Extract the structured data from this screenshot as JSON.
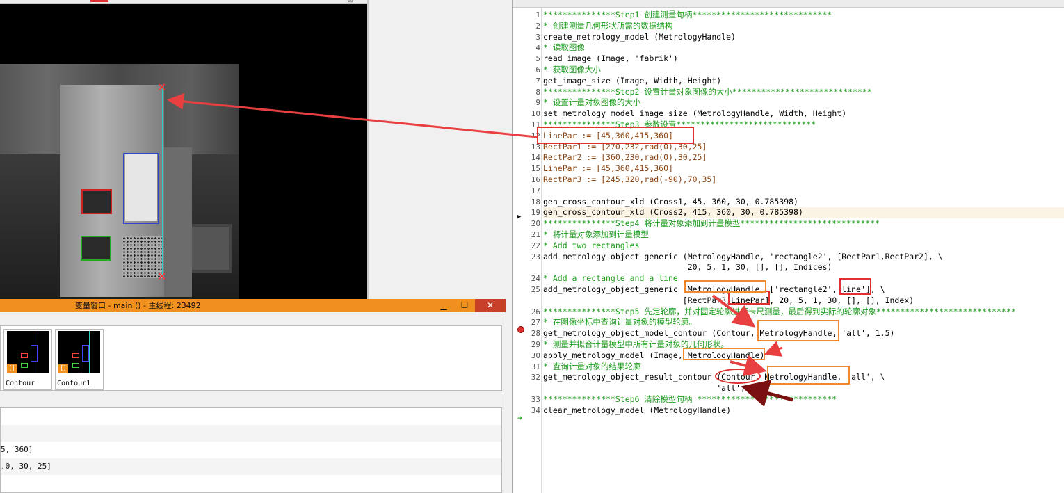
{
  "variable_window": {
    "title": "变量窗口 - main () - 主线程: 23492",
    "thumbs": [
      {
        "label": "Contour",
        "badge": "[]"
      },
      {
        "label": "Contour1",
        "badge": "[]"
      }
    ],
    "rows": [
      "",
      "",
      "5, 360]",
      ".0, 30, 25]"
    ]
  },
  "editor": {
    "lines": [
      {
        "n": "1",
        "t": "***************Step1 创建测量句柄*****************************",
        "c": "cmt"
      },
      {
        "n": "2",
        "t": "* 创建测量几何形状所需的数据结构",
        "c": "cmt"
      },
      {
        "n": "3",
        "t": "create_metrology_model (MetrologyHandle)",
        "c": "kw"
      },
      {
        "n": "4",
        "t": "* 读取图像",
        "c": "cmt"
      },
      {
        "n": "5",
        "t": "read_image (Image, 'fabrik')",
        "c": "kw"
      },
      {
        "n": "6",
        "t": "* 获取图像大小",
        "c": "cmt"
      },
      {
        "n": "7",
        "t": "get_image_size (Image, Width, Height)",
        "c": "kw"
      },
      {
        "n": "8",
        "t": "***************Step2 设置计量对象图像的大小*****************************",
        "c": "cmt"
      },
      {
        "n": "9",
        "t": "* 设置计量对象图像的大小",
        "c": "cmt"
      },
      {
        "n": "10",
        "t": "set_metrology_model_image_size (MetrologyHandle, Width, Height)",
        "c": "kw"
      },
      {
        "n": "11",
        "t": "***************Step3 参数设置*****************************",
        "c": "cmt"
      },
      {
        "n": "12",
        "t": "LinePar := [45,360,415,360]",
        "c": "var"
      },
      {
        "n": "13",
        "t": "RectPar1 := [270,232,rad(0),30,25]",
        "c": "var"
      },
      {
        "n": "14",
        "t": "RectPar2 := [360,230,rad(0),30,25]",
        "c": "var"
      },
      {
        "n": "15",
        "t": "LinePar := [45,360,415,360]",
        "c": "var"
      },
      {
        "n": "16",
        "t": "RectPar3 := [245,320,rad(-90),70,35]",
        "c": "var"
      },
      {
        "n": "17",
        "t": "",
        "c": "kw"
      },
      {
        "n": "18",
        "t": "gen_cross_contour_xld (Cross1, 45, 360, 30, 0.785398)",
        "c": "kw"
      },
      {
        "n": "19",
        "t": "gen_cross_contour_xld (Cross2, 415, 360, 30, 0.785398)",
        "c": "kw"
      },
      {
        "n": "20",
        "t": "***************Step4 将计量对象添加到计量模型*****************************",
        "c": "cmt"
      },
      {
        "n": "21",
        "t": "* 将计量对象添加到计量模型",
        "c": "cmt"
      },
      {
        "n": "22",
        "t": "* Add two rectangles",
        "c": "cmt"
      },
      {
        "n": "23",
        "t": "add_metrology_object_generic (MetrologyHandle, 'rectangle2', [RectPar1,RectPar2], \\",
        "c": "kw"
      },
      {
        "n": "",
        "t": "                              20, 5, 1, 30, [], [], Indices)",
        "c": "kw"
      },
      {
        "n": "24",
        "t": "* Add a rectangle and a line",
        "c": "cmt"
      },
      {
        "n": "25",
        "t": "add_metrology_object_generic (MetrologyHandle, ['rectangle2','line'], \\",
        "c": "kw"
      },
      {
        "n": "",
        "t": "                             [RectPar3,LinePar], 20, 5, 1, 30, [], [], Index)",
        "c": "kw"
      },
      {
        "n": "26",
        "t": "***************Step5 先定轮廓，并对固定轮廓进行卡尺测量，最后得到实际的轮廓对象*****************************",
        "c": "cmt"
      },
      {
        "n": "27",
        "t": "* 在图像坐标中查询计量对象的模型轮廓。",
        "c": "cmt"
      },
      {
        "n": "28",
        "t": "get_metrology_object_model_contour (Contour, MetrologyHandle, 'all', 1.5)",
        "c": "kw"
      },
      {
        "n": "29",
        "t": "* 测量并拟合计量模型中所有计量对象的几何形状。",
        "c": "cmt"
      },
      {
        "n": "30",
        "t": "apply_metrology_model (Image, MetrologyHandle)",
        "c": "kw"
      },
      {
        "n": "31",
        "t": "* 查询计量对象的结果轮廓",
        "c": "cmt"
      },
      {
        "n": "32",
        "t": "get_metrology_object_result_contour (Contour, MetrologyHandle, 'all', \\",
        "c": "kw"
      },
      {
        "n": "",
        "t": "                                    'all', 1.5)",
        "c": "kw"
      },
      {
        "n": "33",
        "t": "***************Step6 清除模型句柄 *****************************",
        "c": "cmt"
      },
      {
        "n": "34",
        "t": "clear_metrology_model (MetrologyHandle)",
        "c": "kw"
      }
    ]
  }
}
